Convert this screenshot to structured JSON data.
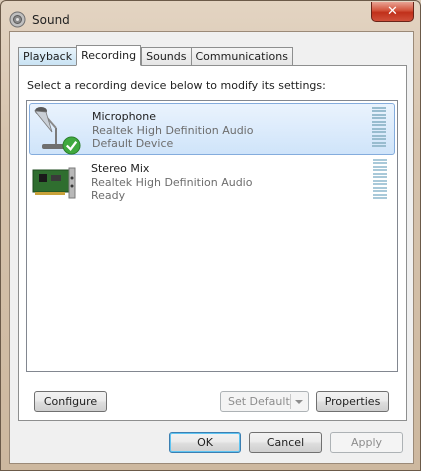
{
  "window": {
    "title": "Sound",
    "close_glyph": "✕"
  },
  "tabs": [
    {
      "label": "Playback",
      "active": false
    },
    {
      "label": "Recording",
      "active": true
    },
    {
      "label": "Sounds",
      "active": false
    },
    {
      "label": "Communications",
      "active": false
    }
  ],
  "recording": {
    "instruction": "Select a recording device below to modify its settings:",
    "devices": [
      {
        "name": "Microphone",
        "driver": "Realtek High Definition Audio",
        "status": "Default Device",
        "icon": "microphone-icon",
        "default_badge": "check-icon",
        "selected": true
      },
      {
        "name": "Stereo Mix",
        "driver": "Realtek High Definition Audio",
        "status": "Ready",
        "icon": "sound-card-icon",
        "selected": false
      }
    ],
    "configure_label": "Configure",
    "set_default_label": "Set Default",
    "properties_label": "Properties"
  },
  "footer": {
    "ok_label": "OK",
    "cancel_label": "Cancel",
    "apply_label": "Apply"
  },
  "colors": {
    "selection": "#cfe4fa",
    "selection_border": "#84acdd",
    "close_button": "#c0301a",
    "meter": "#a9c9d9"
  }
}
